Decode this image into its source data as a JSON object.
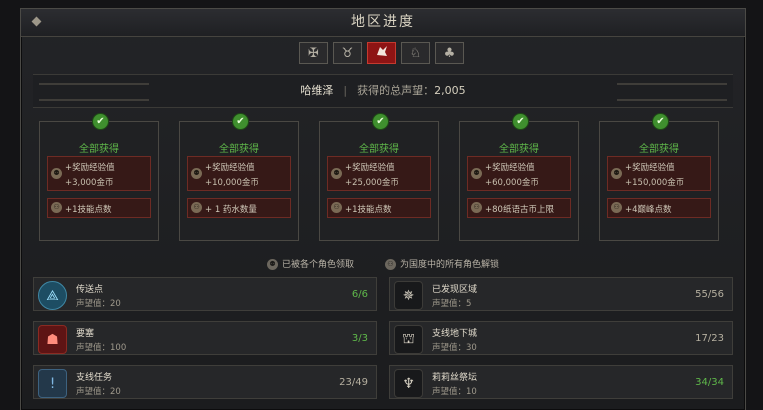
{
  "window": {
    "title": "地区进度"
  },
  "tabs": [
    {
      "name": "tab-region-1",
      "icon": "ornate-cross-icon",
      "glyph": "✠"
    },
    {
      "name": "tab-region-2",
      "icon": "goat-skull-icon",
      "glyph": "♉"
    },
    {
      "name": "tab-region-3",
      "icon": "dragon-head-icon",
      "glyph": "🐉",
      "active": true
    },
    {
      "name": "tab-region-4",
      "icon": "beast-head-icon",
      "glyph": "♘"
    },
    {
      "name": "tab-region-5",
      "icon": "tree-icon",
      "glyph": "♣"
    }
  ],
  "banner": {
    "region": "哈维泽",
    "separator": "|",
    "total_label": "获得的总声望：",
    "total_value": "2,005"
  },
  "rewards": [
    {
      "status": "全部获得",
      "xp_label": "+奖励经验值",
      "gold": "+3,000金币",
      "extra": "+1技能点数"
    },
    {
      "status": "全部获得",
      "xp_label": "+奖励经验值",
      "gold": "+10,000金币",
      "extra": "+ 1 药水数量"
    },
    {
      "status": "全部获得",
      "xp_label": "+奖励经验值",
      "gold": "+25,000金币",
      "extra": "+1技能点数"
    },
    {
      "status": "全部获得",
      "xp_label": "+奖励经验值",
      "gold": "+60,000金币",
      "extra": "+80纸语古币上限"
    },
    {
      "status": "全部获得",
      "xp_label": "+奖励经验值",
      "gold": "+150,000金币",
      "extra": "+4巅峰点数"
    }
  ],
  "legend": {
    "per_character": "已被各个角色领取",
    "all_characters": "为国度中的所有角色解锁"
  },
  "stats": {
    "left": [
      {
        "name": "传送点",
        "rep": "声望值：20",
        "count": "6/6",
        "done": true,
        "icon": "waypoint-icon",
        "glyph": "⟁"
      },
      {
        "name": "要塞",
        "rep": "声望值：100",
        "count": "3/3",
        "done": true,
        "icon": "stronghold-icon",
        "glyph": "☗"
      },
      {
        "name": "支线任务",
        "rep": "声望值：20",
        "count": "23/49",
        "done": false,
        "icon": "quest-icon",
        "glyph": "!"
      }
    ],
    "right": [
      {
        "name": "已发现区域",
        "rep": "声望值：5",
        "count": "55/56",
        "done": false,
        "icon": "compass-icon",
        "glyph": "✵"
      },
      {
        "name": "支线地下城",
        "rep": "声望值：30",
        "count": "17/23",
        "done": false,
        "icon": "dungeon-gate-icon",
        "glyph": "⛫"
      },
      {
        "name": "莉莉丝祭坛",
        "rep": "声望值：10",
        "count": "34/34",
        "done": true,
        "icon": "lilith-altar-icon",
        "glyph": "♆"
      }
    ]
  }
}
